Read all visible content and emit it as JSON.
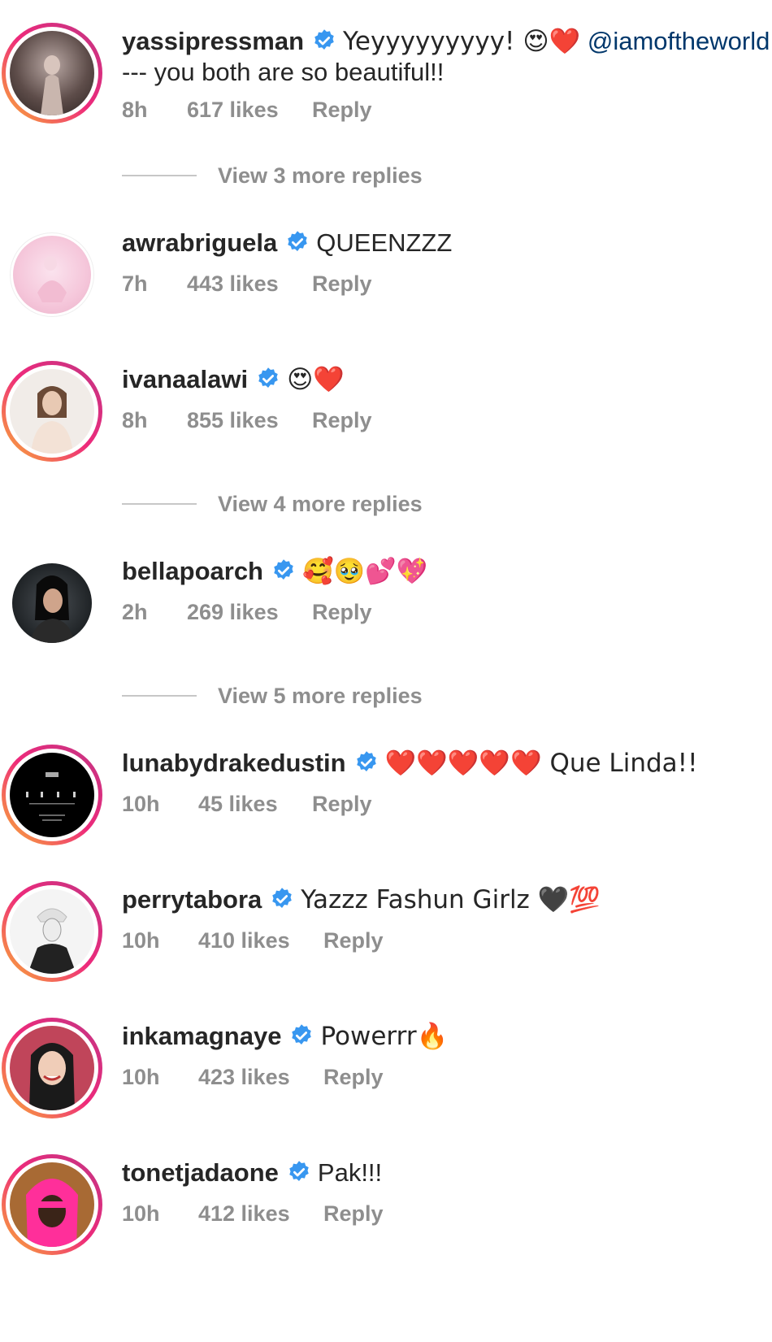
{
  "comments": [
    {
      "username": "yassipressman",
      "text": "Yeyyyyyyyyy! 😍❤️",
      "mention": "@iamoftheworld",
      "text_line2": "--- you both are so beautiful!!",
      "time": "8h",
      "likes": "617 likes",
      "reply": "Reply",
      "view_replies": "View 3 more replies"
    },
    {
      "username": "awrabriguela",
      "text": "QUEENZZZ",
      "time": "7h",
      "likes": "443 likes",
      "reply": "Reply"
    },
    {
      "username": "ivanaalawi",
      "text": "😍❤️",
      "time": "8h",
      "likes": "855 likes",
      "reply": "Reply",
      "view_replies": "View 4 more replies"
    },
    {
      "username": "bellapoarch",
      "text": "🥰🥹💕💖",
      "time": "2h",
      "likes": "269 likes",
      "reply": "Reply",
      "view_replies": "View 5 more replies"
    },
    {
      "username": "lunabydrakedustin",
      "text": "❤️❤️❤️❤️❤️ Que Linda!!",
      "time": "10h",
      "likes": "45 likes",
      "reply": "Reply"
    },
    {
      "username": "perrytabora",
      "text": "Yazzz Fashun Girlz 🖤💯",
      "time": "10h",
      "likes": "410 likes",
      "reply": "Reply"
    },
    {
      "username": "inkamagnaye",
      "text": "Powerrr🔥",
      "time": "10h",
      "likes": "423 likes",
      "reply": "Reply"
    },
    {
      "username": "tonetjadaone",
      "text": "Pak!!!",
      "time": "10h",
      "likes": "412 likes",
      "reply": "Reply"
    }
  ],
  "colors": {
    "verified_badge": "#3897f0",
    "mention": "#00376b",
    "meta_text": "#8e8e8e"
  }
}
